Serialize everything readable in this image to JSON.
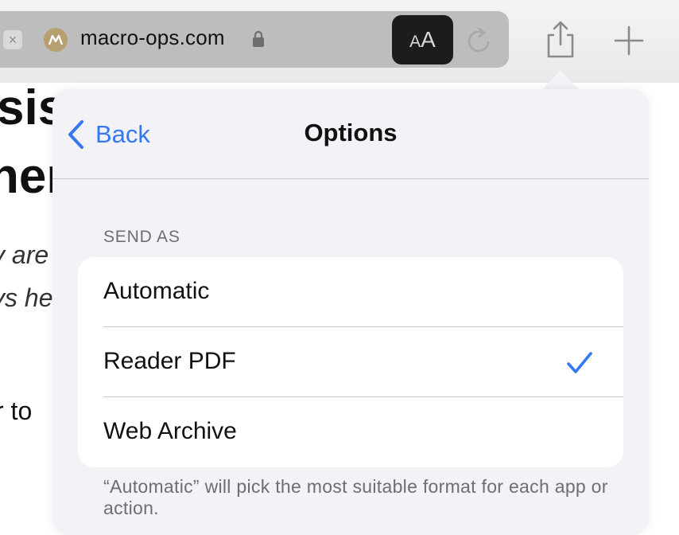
{
  "browser": {
    "domain": "macro-ops.com",
    "reader_button": {
      "small": "A",
      "large": "A"
    },
    "tab_close_glyph": "×",
    "icons": [
      "close-icon",
      "site-logo-icon",
      "lock-icon",
      "reader-mode-icon",
      "reload-icon",
      "share-icon",
      "plus-icon"
    ]
  },
  "article": {
    "heading_line_1": "sis",
    "heading_line_2": "ner",
    "italic_line_1": "y are",
    "italic_line_2": "ys he",
    "body_line": "r to"
  },
  "popover": {
    "back_label": "Back",
    "title": "Options",
    "section_header": "SEND AS",
    "options": [
      {
        "label": "Automatic",
        "selected": false
      },
      {
        "label": "Reader PDF",
        "selected": true
      },
      {
        "label": "Web Archive",
        "selected": false
      }
    ],
    "footer_note": "“Automatic” will pick the most suitable format for each app or action.",
    "accent_color": "#3478f6"
  }
}
